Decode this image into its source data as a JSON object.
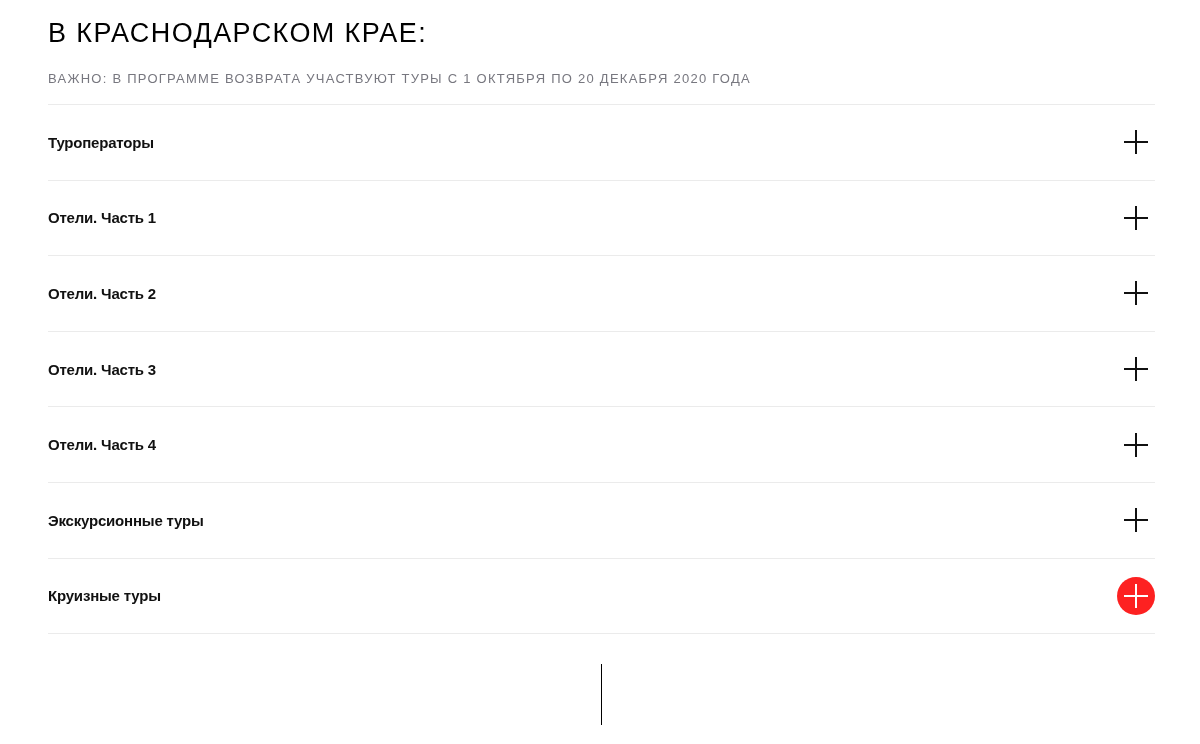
{
  "section": {
    "title": "В КРАСНОДАРСКОМ КРАЕ:",
    "note": "ВАЖНО: В ПРОГРАММЕ ВОЗВРАТА УЧАСТВУЮТ ТУРЫ С 1 ОКТЯБРЯ ПО 20 ДЕКАБРЯ 2020 ГОДА",
    "items": [
      {
        "label": "Туроператоры",
        "expanded": false,
        "highlighted": false
      },
      {
        "label": "Отели. Часть 1",
        "expanded": false,
        "highlighted": false
      },
      {
        "label": "Отели. Часть 2",
        "expanded": false,
        "highlighted": false
      },
      {
        "label": "Отели. Часть 3",
        "expanded": false,
        "highlighted": false
      },
      {
        "label": "Отели. Часть 4",
        "expanded": false,
        "highlighted": false
      },
      {
        "label": "Экскурсионные туры",
        "expanded": false,
        "highlighted": false
      },
      {
        "label": "Круизные туры",
        "expanded": false,
        "highlighted": true
      }
    ]
  }
}
